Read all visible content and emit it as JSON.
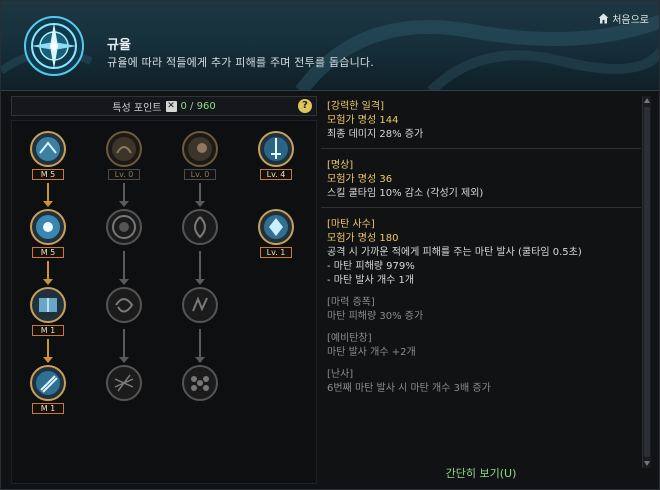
{
  "header": {
    "title": "규율",
    "description": "규율에 따라 적들에게 추가 피해를 주며 전투를 돕습니다.",
    "home_label": "처음으로",
    "emblem_icon": "compass-icon"
  },
  "points": {
    "label": "특성 포인트",
    "value": "0 / 960",
    "help": "?"
  },
  "tree": {
    "columns": [
      [
        "M 5",
        "M 5",
        "M 1",
        "M 1"
      ],
      [
        "Lv. 0"
      ],
      [
        "Lv. 0"
      ],
      [
        "Lv. 4",
        "Lv. 1"
      ]
    ]
  },
  "details": [
    {
      "title": "[강력한 일격]",
      "fame": "모험가 명성 144",
      "desc": "최종 데미지 28% 증가"
    },
    {
      "title": "[명상]",
      "fame": "모험가 명성 36",
      "desc": "스킬 쿨타임 10% 감소 (각성기 제외)"
    },
    {
      "title": "[마탄 사수]",
      "fame": "모험가 명성 180",
      "desc": "공격 시 가까운 적에게 피해를 주는 마탄 발사 (쿨타임 0.5초)",
      "line2": "- 마탄 피해량 979%",
      "line3": "- 마탄 발사 개수 1개",
      "subs": [
        {
          "title": "[마력 증폭]",
          "desc": "마탄 피해량 30% 증가"
        },
        {
          "title": "[예비탄창]",
          "desc": "마탄 발사 개수 +2개"
        },
        {
          "title": "[난사]",
          "desc": "6번째 마탄 발사 시 마탄 개수 3배 증가"
        }
      ]
    }
  ],
  "footer": {
    "simple_view": "간단히 보기(U)"
  }
}
